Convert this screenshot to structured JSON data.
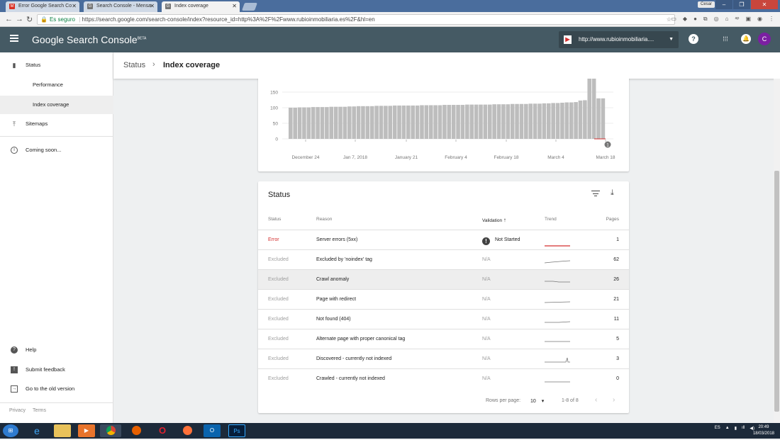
{
  "browser": {
    "tabs": [
      {
        "title": "Error Google Search Co",
        "icon": "mail-icon"
      },
      {
        "title": "Search Console - Mensa",
        "icon": "search-console-icon"
      },
      {
        "title": "Index coverage",
        "icon": "search-console-icon"
      }
    ],
    "user_label": "Cesar",
    "secure_label": "Es seguro",
    "url": "https://search.google.com/search-console/index?resource_id=http%3A%2F%2Fwww.rubioinmobiliaria.es%2F&hl=en"
  },
  "header": {
    "brand": "Google Search Console",
    "brand_sup": "BETA",
    "property": "http://www.rubioinmobiliaria....",
    "avatar_letter": "C"
  },
  "sidebar": {
    "items": [
      {
        "label": "Status",
        "icon": "bar-chart-icon"
      },
      {
        "label": "Performance"
      },
      {
        "label": "Index coverage"
      },
      {
        "label": "Sitemaps",
        "icon": "upload-icon"
      },
      {
        "label": "Coming soon...",
        "icon": "info-icon"
      },
      {
        "label": "Help",
        "icon": "help-icon"
      },
      {
        "label": "Submit feedback",
        "icon": "feedback-icon"
      },
      {
        "label": "Go to the old version",
        "icon": "exit-icon"
      }
    ],
    "privacy": "Privacy",
    "terms": "Terms"
  },
  "breadcrumb": {
    "parent": "Status",
    "current": "Index coverage"
  },
  "chart_data": {
    "type": "bar",
    "yticks": [
      "150",
      "100",
      "50",
      "0"
    ],
    "ylim": [
      0,
      210
    ],
    "xticks": [
      "December 24",
      "Jan 7, 2018",
      "January 21",
      "February 4",
      "February 18",
      "March 4",
      "March 18"
    ],
    "values": [
      100,
      100,
      101,
      101,
      101,
      102,
      102,
      102,
      102,
      103,
      103,
      103,
      103,
      104,
      104,
      105,
      105,
      105,
      105,
      106,
      106,
      106,
      106,
      107,
      107,
      107,
      107,
      107,
      107,
      108,
      108,
      108,
      108,
      108,
      109,
      109,
      109,
      109,
      109,
      110,
      110,
      110,
      110,
      110,
      110,
      111,
      111,
      111,
      111,
      112,
      112,
      112,
      112,
      113,
      113,
      113,
      114,
      114,
      115,
      115,
      116,
      117,
      117,
      118,
      123,
      124,
      206,
      206,
      130,
      130
    ],
    "error_values_note": "",
    "annotation": "1"
  },
  "status_table": {
    "title": "Status",
    "headers": {
      "status": "Status",
      "reason": "Reason",
      "validation": "Validation",
      "trend": "Trend",
      "pages": "Pages"
    },
    "rows": [
      {
        "status": "Error",
        "reason": "Server errors (5xx)",
        "validation": "Not Started",
        "pages": "1"
      },
      {
        "status": "Excluded",
        "reason": "Excluded by 'noindex' tag",
        "validation": "N/A",
        "pages": "62"
      },
      {
        "status": "Excluded",
        "reason": "Crawl anomaly",
        "validation": "N/A",
        "pages": "26"
      },
      {
        "status": "Excluded",
        "reason": "Page with redirect",
        "validation": "N/A",
        "pages": "21"
      },
      {
        "status": "Excluded",
        "reason": "Not found (404)",
        "validation": "N/A",
        "pages": "11"
      },
      {
        "status": "Excluded",
        "reason": "Alternate page with proper canonical tag",
        "validation": "N/A",
        "pages": "5"
      },
      {
        "status": "Excluded",
        "reason": "Discovered - currently not indexed",
        "validation": "N/A",
        "pages": "3"
      },
      {
        "status": "Excluded",
        "reason": "Crawled - currently not indexed",
        "validation": "N/A",
        "pages": "0"
      }
    ],
    "rows_per_page_label": "Rows per page:",
    "rows_per_page": "10",
    "range": "1-8 of 8"
  },
  "taskbar": {
    "lang": "ES",
    "time": "20:49",
    "date": "18/03/2018"
  },
  "colors": {
    "header": "#455a64",
    "error": "#d32f2f",
    "bars": "#bdbdbd"
  }
}
